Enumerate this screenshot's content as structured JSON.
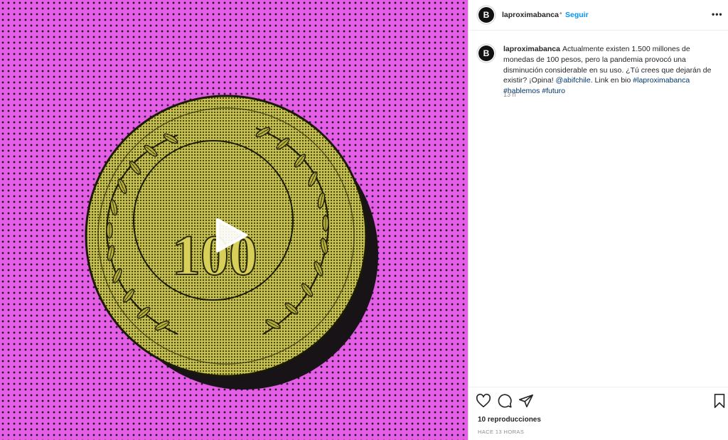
{
  "post": {
    "username": "laproximabanca",
    "follow_label": "Seguir",
    "separator": "•",
    "more_label": "•••",
    "avatar_letter": "B",
    "media": {
      "coin_text": "100"
    },
    "caption": {
      "text_part1": "Actualmente existen 1.500 millones de monedas de 100 pesos, pero la pandemia provocó una disminución considerable en su uso. ¿Tú crees que dejarán de existir? ¡Opina! ",
      "mention": "@abifchile",
      "text_part2": ". Link en bio ",
      "hashtags": [
        "#laproximabanca",
        "#hablemos",
        "#futuro"
      ]
    },
    "time_ago": "13 h",
    "views": "10 reproducciones",
    "timestamp": "HACE 13 HORAS"
  },
  "icons": {
    "like": "heart-icon",
    "comment": "comment-icon",
    "share": "share-icon",
    "save": "bookmark-icon",
    "play": "play-icon"
  },
  "colors": {
    "background_media": "#e45fe6",
    "coin": "#b9b23a",
    "link_blue": "#0095f6",
    "hashtag_blue": "#00376b"
  }
}
